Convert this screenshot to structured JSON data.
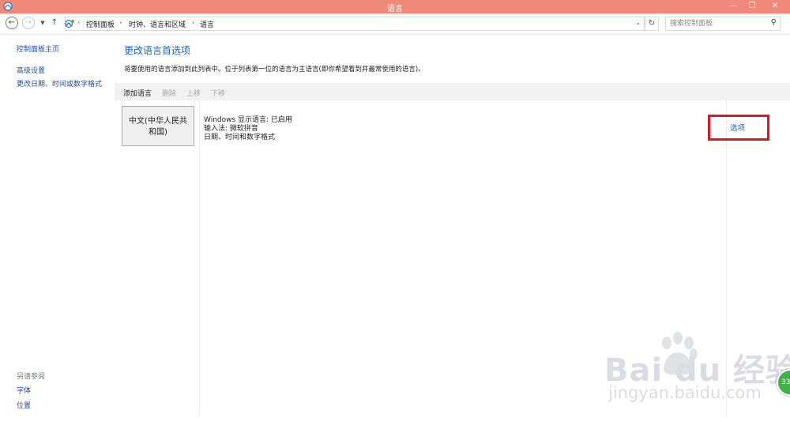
{
  "window": {
    "title": "语言",
    "controls": {
      "minimize": "—",
      "restore": "❐",
      "close": "✕"
    }
  },
  "address_bar": {
    "back_icon": "back-arrow-icon",
    "forward_icon": "forward-arrow-icon",
    "up_icon": "up-arrow-icon",
    "breadcrumbs": [
      "控制面板",
      "时钟、语言和区域",
      "语言"
    ],
    "search_placeholder": "搜索控制面板"
  },
  "sidebar": {
    "home": "控制面板主页",
    "links": [
      "高级设置",
      "更改日期、时间或数字格式"
    ],
    "see_also_label": "另请参阅",
    "see_also_links": [
      "字体",
      "位置"
    ]
  },
  "main": {
    "title": "更改语言首选项",
    "description": "将要使用的语言添加到此列表中。位于列表第一位的语言为主语言(即你希望看到并最常使用的语言)。",
    "toolbar": {
      "add": "添加语言",
      "remove": "删除",
      "move_up": "上移",
      "move_down": "下移"
    },
    "languages": [
      {
        "name": "中文(中华人民共和国)",
        "details": [
          "Windows 显示语言: 已启用",
          "输入法: 微软拼音",
          "日期、时间和数字格式"
        ],
        "options_label": "选项"
      }
    ]
  },
  "watermark": {
    "logo_text": "Bai du 经验",
    "url": "jingyan.baidu.com"
  },
  "badge": {
    "text": "33"
  },
  "colors": {
    "titlebar": "#f08979",
    "link": "#1e64b4",
    "highlight_box": "#e2151b",
    "toolbar_bg": "#f1f1f1"
  }
}
